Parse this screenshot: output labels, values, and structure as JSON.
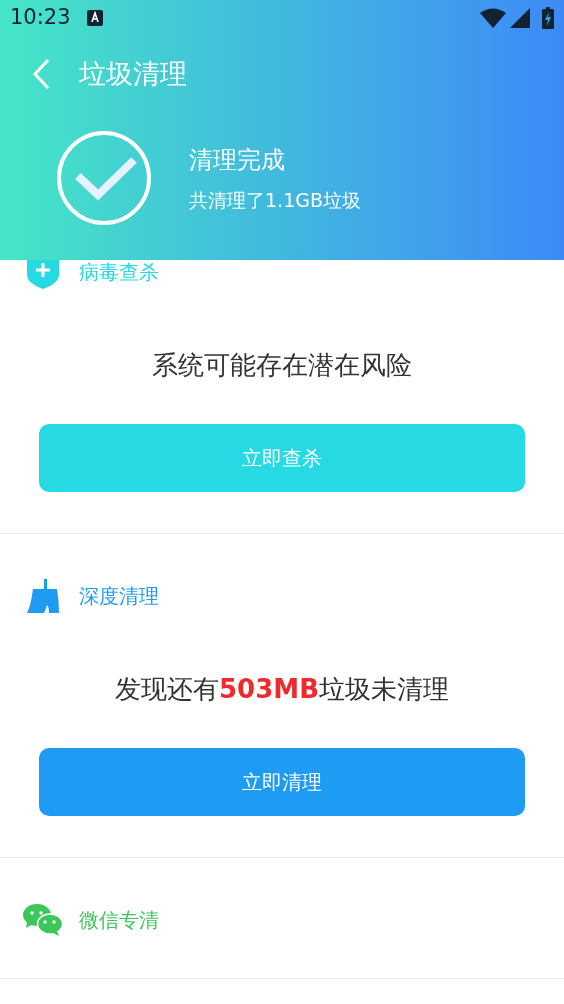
{
  "status_bar": {
    "time": "10:23"
  },
  "app_bar": {
    "title": "垃圾清理"
  },
  "summary": {
    "title": "清理完成",
    "subtitle": "共清理了1.1GB垃圾"
  },
  "sections": [
    {
      "kind": "virus",
      "title": "病毒查杀",
      "color": "#26d9e2",
      "message": "系统可能存在潜在风险",
      "button": "立即查杀"
    },
    {
      "kind": "deep",
      "title": "深度清理",
      "color": "#1e9cf4",
      "message": "发现还有**503MB**垃圾未清理",
      "button": "立即清理"
    },
    {
      "kind": "wechat",
      "title": "微信专清",
      "color": "#3cc75a"
    }
  ]
}
